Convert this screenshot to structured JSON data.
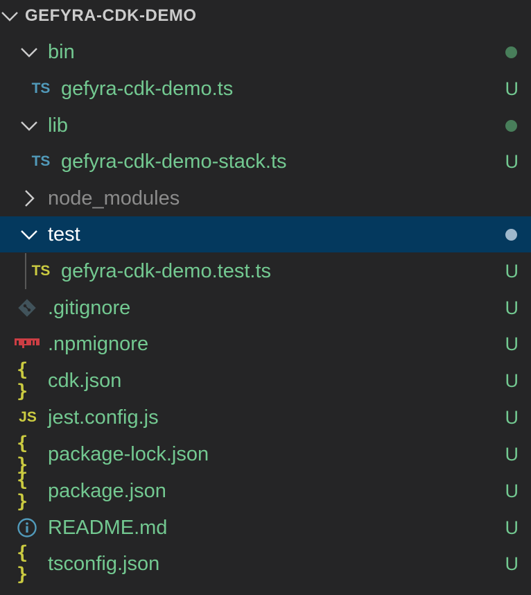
{
  "explorer": {
    "title": "GEFYRA-CDK-DEMO",
    "colors": {
      "background": "#252526",
      "selected": "#04395e",
      "untracked": "#73c991",
      "ignored": "#8c8c8c",
      "ts_blue": "#519aba",
      "ts_yellow": "#cbcb41",
      "json_yellow": "#cbcb41",
      "git_grey": "#41535b",
      "npm_red": "#cc3e44",
      "info_blue": "#519aba"
    },
    "items": [
      {
        "label": "bin",
        "kind": "folder",
        "expanded": true,
        "icon": "chevron-down-icon",
        "status": "dot"
      },
      {
        "label": "gefyra-cdk-demo.ts",
        "kind": "file",
        "icon": "ts-icon",
        "icon_text": "TS",
        "status": "U"
      },
      {
        "label": "lib",
        "kind": "folder",
        "expanded": true,
        "icon": "chevron-down-icon",
        "status": "dot"
      },
      {
        "label": "gefyra-cdk-demo-stack.ts",
        "kind": "file",
        "icon": "ts-icon",
        "icon_text": "TS",
        "status": "U"
      },
      {
        "label": "node_modules",
        "kind": "folder",
        "expanded": false,
        "icon": "chevron-right-icon",
        "status": ""
      },
      {
        "label": "test",
        "kind": "folder",
        "expanded": true,
        "icon": "chevron-down-icon",
        "status": "dot",
        "selected": true
      },
      {
        "label": "gefyra-cdk-demo.test.ts",
        "kind": "file",
        "icon": "ts-test-icon",
        "icon_text": "TS",
        "status": "U"
      },
      {
        "label": ".gitignore",
        "kind": "file",
        "icon": "git-icon",
        "status": "U"
      },
      {
        "label": ".npmignore",
        "kind": "file",
        "icon": "npm-icon",
        "status": "U"
      },
      {
        "label": "cdk.json",
        "kind": "file",
        "icon": "json-icon",
        "icon_text": "{ }",
        "status": "U"
      },
      {
        "label": "jest.config.js",
        "kind": "file",
        "icon": "js-icon",
        "icon_text": "JS",
        "status": "U"
      },
      {
        "label": "package-lock.json",
        "kind": "file",
        "icon": "json-icon",
        "icon_text": "{ }",
        "status": "U"
      },
      {
        "label": "package.json",
        "kind": "file",
        "icon": "json-icon",
        "icon_text": "{ }",
        "status": "U"
      },
      {
        "label": "README.md",
        "kind": "file",
        "icon": "info-icon",
        "status": "U"
      },
      {
        "label": "tsconfig.json",
        "kind": "file",
        "icon": "json-icon",
        "icon_text": "{ }",
        "status": "U"
      }
    ]
  }
}
